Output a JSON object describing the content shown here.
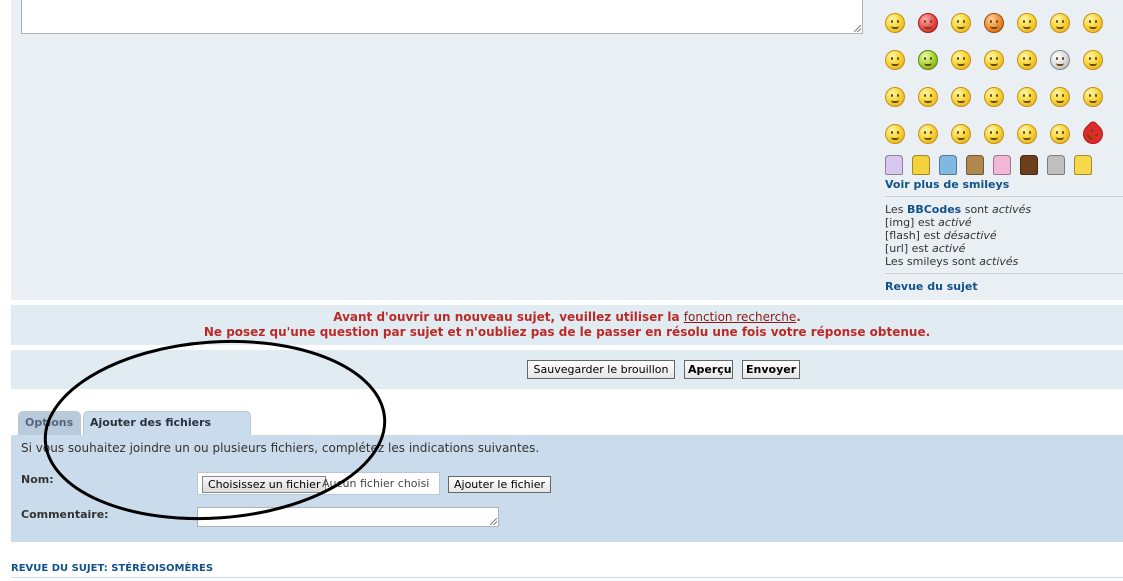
{
  "smileys": {
    "rows": [
      [
        "laugh-party-icon",
        "angry-red-icon",
        "teddy-smile-icon",
        "pumpkin-icon",
        "confused-question-icon",
        "grin-teeth-icon",
        "big-laugh-icon"
      ],
      [
        "sad-icon",
        "sick-green-icon",
        "worried-icon",
        "surprised-icon",
        "grimace-icon",
        "skull-icon",
        "sunglasses-cool-icon"
      ],
      [
        "thinking-icon",
        "hmm-icon",
        "blush-icon",
        "sweat-icon",
        "wink-icon",
        "neutral-icon",
        "helmet-icon"
      ],
      [
        "doh-icon",
        "hand-mouth-icon",
        "meh-icon",
        "rolling-eyes-icon",
        "shy-icon",
        "shock-icon",
        "heart-love-icon"
      ]
    ],
    "mascots": [
      "unicorn-icon",
      "pikachu-icon",
      "squirtle-icon",
      "eevee-icon",
      "mew-icon",
      "poop-icon",
      "bowl-icon",
      "homer-icon"
    ],
    "more_label": "Voir plus de smileys"
  },
  "bbcode_info": {
    "line1_prefix": "Les ",
    "bbcodes_link": "BBCodes",
    "line1_mid": " sont ",
    "line1_state": "activés",
    "img_label": "[img] est ",
    "img_state": "activé",
    "flash_label": "[flash] est ",
    "flash_state": "désactivé",
    "url_label": "[url] est ",
    "url_state": "activé",
    "smileys_label": "Les smileys sont ",
    "smileys_state": "activés"
  },
  "review_link": "Revue du sujet",
  "notice": {
    "line1_before": "Avant d'ouvrir un nouveau sujet, veuillez utiliser la ",
    "line1_link": "fonction recherche",
    "line1_after": ".",
    "line2": "Ne posez qu'une question par sujet et n'oubliez pas de le passer en résolu une fois votre réponse obtenue."
  },
  "buttons": {
    "save_draft": "Sauvegarder le brouillon",
    "preview": "Aperçu",
    "submit": "Envoyer"
  },
  "tabs": {
    "options": "Options",
    "attachments": "Ajouter des fichiers joints"
  },
  "attachments": {
    "intro": "Si vous souhaitez joindre un ou plusieurs fichiers, complétez les indications suivantes.",
    "name_label": "Nom:",
    "choose_file": "Choisissez un fichier",
    "no_file": "Aucun fichier choisi",
    "add_file": "Ajouter le fichier",
    "comment_label": "Commentaire:"
  },
  "topic_review_title": "REVUE DU SUJET: STÉRÉOISOMÈRES",
  "colors": {
    "panel_bg": "#eaeff3",
    "notice_bg": "#e1ebf2",
    "attach_bg": "#cadceb",
    "link_blue": "#105289",
    "notice_red": "#bc2a28"
  }
}
